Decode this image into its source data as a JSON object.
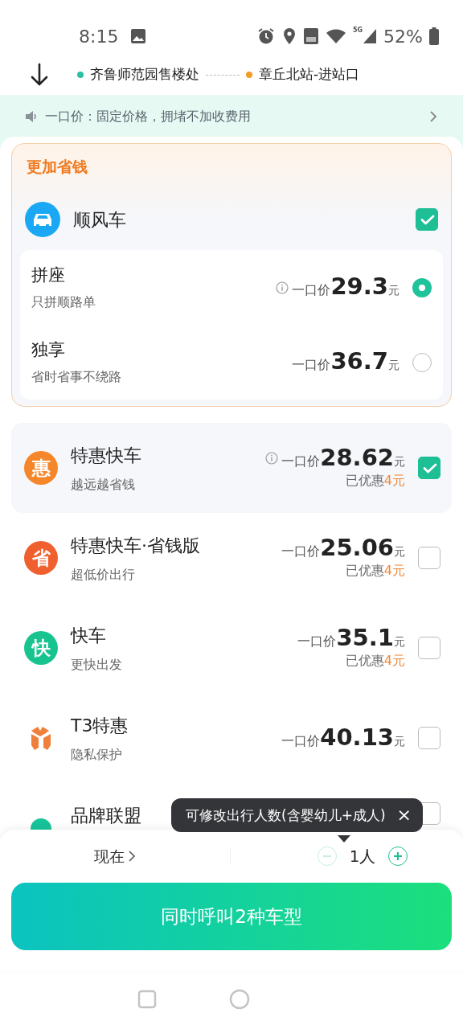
{
  "status_bar": {
    "time": "8:15",
    "network": "5G",
    "battery": "52%"
  },
  "route": {
    "origin": "齐鲁师范园售楼处",
    "destination": "章丘北站-进站口"
  },
  "notice": {
    "text": "一口价：固定价格，拥堵不加收费用"
  },
  "savings_section": {
    "title": "更加省钱",
    "group": {
      "name": "顺风车",
      "checked": true,
      "options": [
        {
          "name": "拼座",
          "subtitle": "只拼顺路单",
          "info": true,
          "price_label": "一口价",
          "price": "29.3",
          "unit": "元",
          "selected": true
        },
        {
          "name": "独享",
          "subtitle": "省时省事不绕路",
          "info": false,
          "price_label": "一口价",
          "price": "36.7",
          "unit": "元",
          "selected": false
        }
      ]
    }
  },
  "rides": [
    {
      "kind": "glyph",
      "icon_text": "惠",
      "color": "#f5862a",
      "name": "特惠快车",
      "subtitle": "越远越省钱",
      "info": true,
      "price_label": "一口价",
      "price": "28.62",
      "unit": "元",
      "discount_label": "已优惠",
      "discount": "4元",
      "checked": true
    },
    {
      "kind": "glyph",
      "icon_text": "省",
      "color": "#f0602f",
      "name": "特惠快车·省钱版",
      "subtitle": "超低价出行",
      "info": false,
      "price_label": "一口价",
      "price": "25.06",
      "unit": "元",
      "discount_label": "已优惠",
      "discount": "4元",
      "checked": false
    },
    {
      "kind": "glyph",
      "icon_text": "快",
      "color": "#17c48f",
      "name": "快车",
      "subtitle": "更快出发",
      "info": false,
      "price_label": "一口价",
      "price": "35.1",
      "unit": "元",
      "discount_label": "已优惠",
      "discount": "4元",
      "checked": false
    },
    {
      "kind": "t3",
      "color": "#f07f3c",
      "name": "T3特惠",
      "subtitle": "隐私保护",
      "info": false,
      "price_label": "一口价",
      "price": "40.13",
      "unit": "元",
      "checked": false
    },
    {
      "kind": "dot",
      "color": "#17c49a",
      "name": "品牌联盟",
      "checked": false
    }
  ],
  "tooltip": {
    "text": "可修改出行人数(含婴幼儿+成人)",
    "close": "×"
  },
  "bottom_sheet": {
    "time": "现在",
    "passengers": "1人",
    "minus_disabled": true,
    "call_button": "同时呼叫2种车型"
  }
}
